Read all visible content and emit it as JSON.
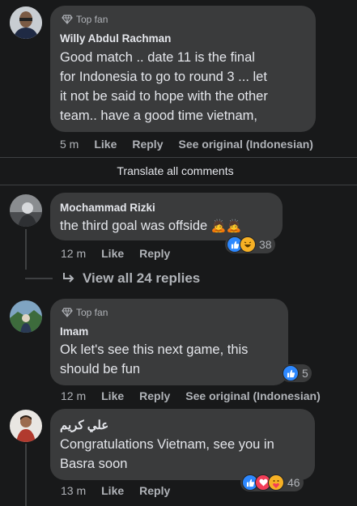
{
  "comments": [
    {
      "badge": "Top fan",
      "author": "Willy Abdul Rachman",
      "text": [
        "Good match .. date 11 is the final",
        "for Indonesia to go to round 3 ... let",
        "it not be said to hope with the other",
        "team.. have a good time vietnam,"
      ],
      "time": "5 m",
      "actions": [
        "Like",
        "Reply",
        "See original (Indonesian)"
      ]
    },
    {
      "author": "Mochammad Rizki",
      "text": "the third goal was offside",
      "emoji": "🙇🙇",
      "time": "12 m",
      "actions": [
        "Like",
        "Reply"
      ],
      "reactions": {
        "icons": [
          "like-icon",
          "haha-icon"
        ],
        "count": "38"
      },
      "view_replies": "View all 24 replies"
    },
    {
      "badge": "Top fan",
      "author": "Imam",
      "text": [
        "Ok let's see this next game, this",
        "should be fun"
      ],
      "time": "12 m",
      "actions": [
        "Like",
        "Reply",
        "See original (Indonesian)"
      ],
      "reactions": {
        "icons": [
          "like-icon"
        ],
        "count": "5"
      }
    },
    {
      "author": "علي كريم",
      "text": [
        "Congratulations Vietnam, see you in",
        "Basra soon"
      ],
      "time": "13 m",
      "actions": [
        "Like",
        "Reply"
      ],
      "reactions": {
        "icons": [
          "like-icon",
          "love-icon",
          "care-icon"
        ],
        "count": "46"
      }
    }
  ],
  "translate_all": "Translate all comments",
  "colors": {
    "background": "#18191a",
    "bubble": "#3a3b3c",
    "like": "#2d88ff",
    "love": "#f33e58",
    "haha": "#f7b125"
  }
}
